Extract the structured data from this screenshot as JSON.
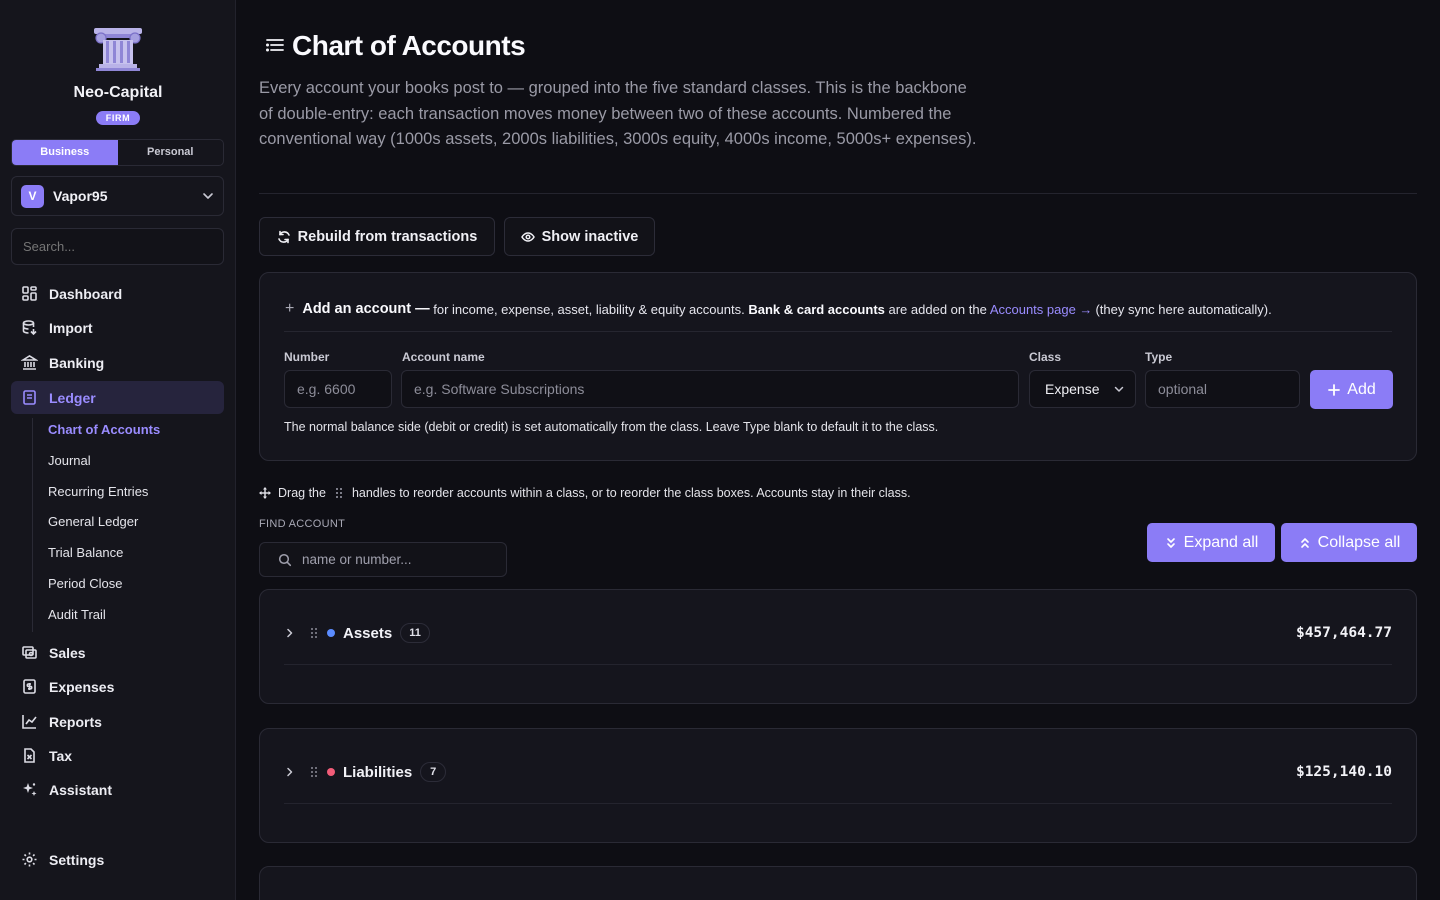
{
  "brand": {
    "name": "Neo-Capital",
    "badge": "FIRM"
  },
  "mode_toggle": {
    "business": "Business",
    "personal": "Personal",
    "active": "Business"
  },
  "org": {
    "initial": "V",
    "name": "Vapor95"
  },
  "sidebar_search": {
    "placeholder": "Search..."
  },
  "nav": {
    "dashboard": "Dashboard",
    "import": "Import",
    "banking": "Banking",
    "ledger": "Ledger",
    "sales": "Sales",
    "expenses": "Expenses",
    "reports": "Reports",
    "tax": "Tax",
    "assistant": "Assistant",
    "settings": "Settings"
  },
  "ledger_sub": {
    "chart_of_accounts": "Chart of Accounts",
    "journal": "Journal",
    "recurring_entries": "Recurring Entries",
    "general_ledger": "General Ledger",
    "trial_balance": "Trial Balance",
    "period_close": "Period Close",
    "audit_trail": "Audit Trail"
  },
  "page": {
    "title": "Chart of Accounts",
    "description": "Every account your books post to — grouped into the five standard classes. This is the backbone of double-entry: each transaction moves money between two of these accounts. Numbered the conventional way (1000s assets, 2000s liabilities, 3000s equity, 4000s income, 5000s+ expenses)."
  },
  "actions": {
    "rebuild": "Rebuild from transactions",
    "show_inactive": "Show inactive"
  },
  "add_account": {
    "title": "Add an account —",
    "desc1": "for income, expense, asset, liability & equity accounts.",
    "bank_bold": "Bank & card accounts",
    "desc2": "are added on the",
    "link": "Accounts page →",
    "desc3": "(they sync here automatically).",
    "labels": {
      "number": "Number",
      "name": "Account name",
      "class": "Class",
      "type": "Type"
    },
    "placeholders": {
      "number": "e.g. 6600",
      "name": "e.g. Software Subscriptions",
      "type": "optional"
    },
    "class_value": "Expense",
    "add_button": "Add",
    "note": "The normal balance side (debit or credit) is set automatically from the class. Leave Type blank to default it to the class."
  },
  "drag_hint": {
    "before": "Drag the",
    "after": "handles to reorder accounts within a class, or to reorder the class boxes. Accounts stay in their class."
  },
  "find": {
    "label": "FIND ACCOUNT",
    "placeholder": "name or number..."
  },
  "bulk": {
    "expand": "Expand all",
    "collapse": "Collapse all"
  },
  "classes": [
    {
      "name": "Assets",
      "count": "11",
      "total": "$457,464.77",
      "color": "#5b8cff"
    },
    {
      "name": "Liabilities",
      "count": "7",
      "total": "$125,140.10",
      "color": "#f25c78"
    }
  ],
  "colors": {
    "accent": "#8b7cf6",
    "accent_text": "#9a8cff",
    "background": "#0e0e14",
    "panel": "#15151d"
  }
}
